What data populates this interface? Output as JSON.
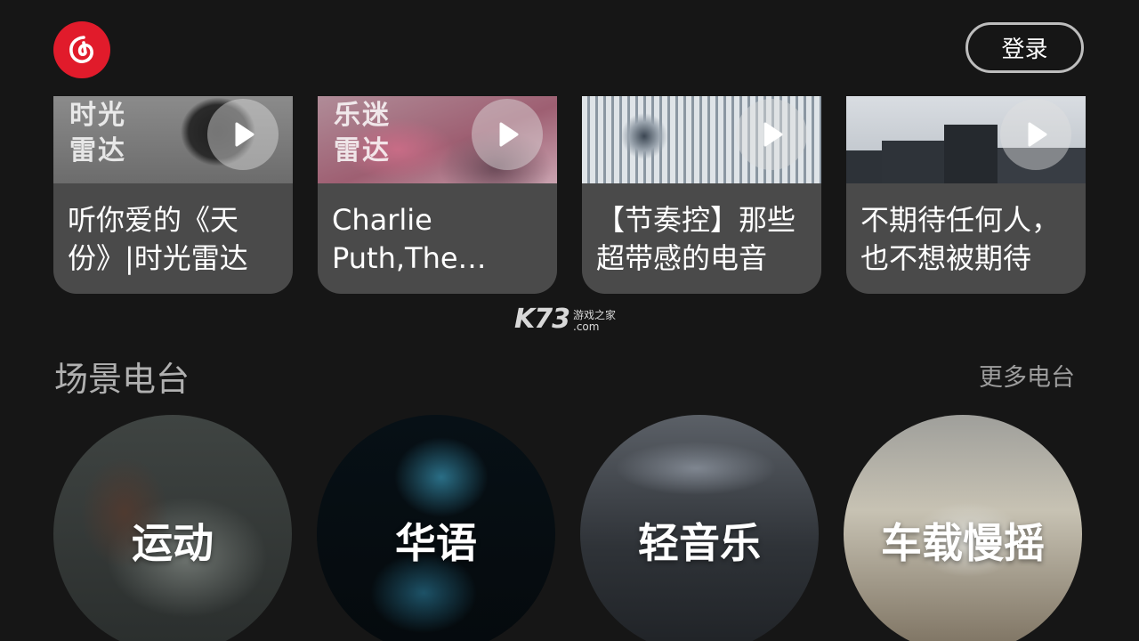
{
  "header": {
    "logo_icon": "netease-music-logo-icon",
    "login_label": "登录"
  },
  "playlist_cards": [
    {
      "cover_tag": "时光雷达",
      "title": "听你爱的《天份》|时光雷达",
      "play_icon": "play-icon"
    },
    {
      "cover_tag": "乐迷雷达",
      "title": "Charlie Puth,The Chainsmokers...",
      "play_icon": "play-icon"
    },
    {
      "cover_tag": "",
      "title": "【节奏控】那些超带感的电音",
      "play_icon": "play-icon"
    },
    {
      "cover_tag": "",
      "title": "不期待任何人，也不想被期待",
      "play_icon": "play-icon"
    }
  ],
  "watermark": {
    "main": "K73",
    "cn": "游戏之家",
    "com": ".com"
  },
  "scene_section": {
    "title": "场景电台",
    "more_label": "更多电台",
    "items": [
      {
        "label": "运动"
      },
      {
        "label": "华语"
      },
      {
        "label": "轻音乐"
      },
      {
        "label": "车载慢摇"
      }
    ]
  },
  "colors": {
    "background": "#161616",
    "brand_red": "#e11b2b",
    "card_bg": "#4a4a4a",
    "section_title": "#b0b0b0"
  }
}
